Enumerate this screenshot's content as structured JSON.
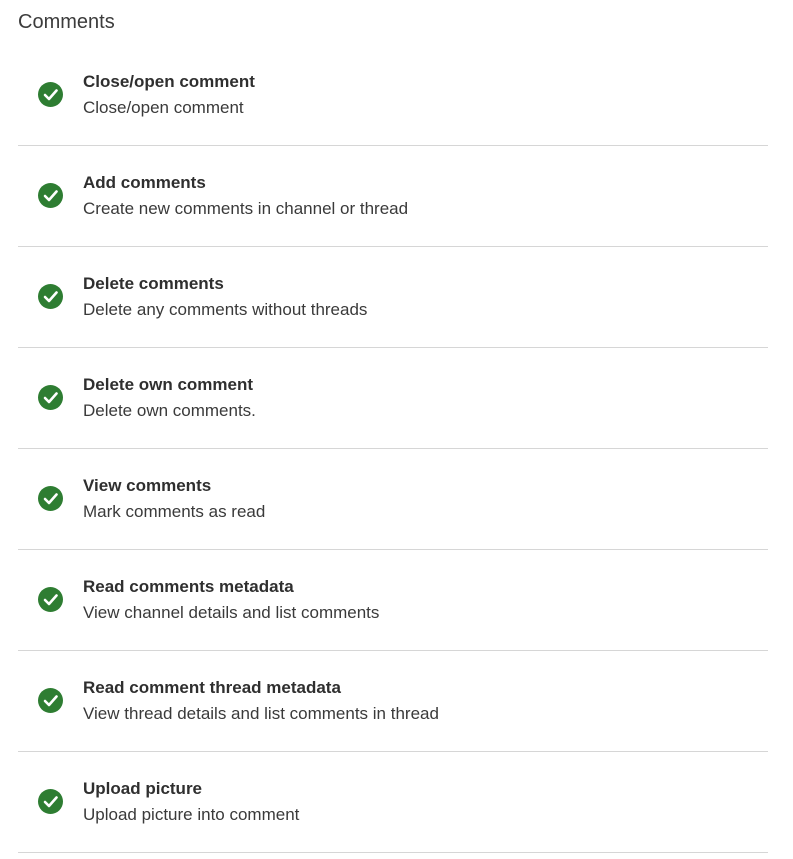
{
  "section": {
    "title": "Comments"
  },
  "colors": {
    "check_fill": "#2e7d32",
    "divider": "#d6d6d6"
  },
  "permissions": [
    {
      "title": "Close/open comment",
      "description": "Close/open comment",
      "status_icon": "check-circle-icon"
    },
    {
      "title": "Add comments",
      "description": "Create new comments in channel or thread",
      "status_icon": "check-circle-icon"
    },
    {
      "title": "Delete comments",
      "description": "Delete any comments without threads",
      "status_icon": "check-circle-icon"
    },
    {
      "title": "Delete own comment",
      "description": "Delete own comments.",
      "status_icon": "check-circle-icon"
    },
    {
      "title": "View comments",
      "description": "Mark comments as read",
      "status_icon": "check-circle-icon"
    },
    {
      "title": "Read comments metadata",
      "description": "View channel details and list comments",
      "status_icon": "check-circle-icon"
    },
    {
      "title": "Read comment thread metadata",
      "description": "View thread details and list comments in thread",
      "status_icon": "check-circle-icon"
    },
    {
      "title": "Upload picture",
      "description": "Upload picture into comment",
      "status_icon": "check-circle-icon"
    }
  ]
}
